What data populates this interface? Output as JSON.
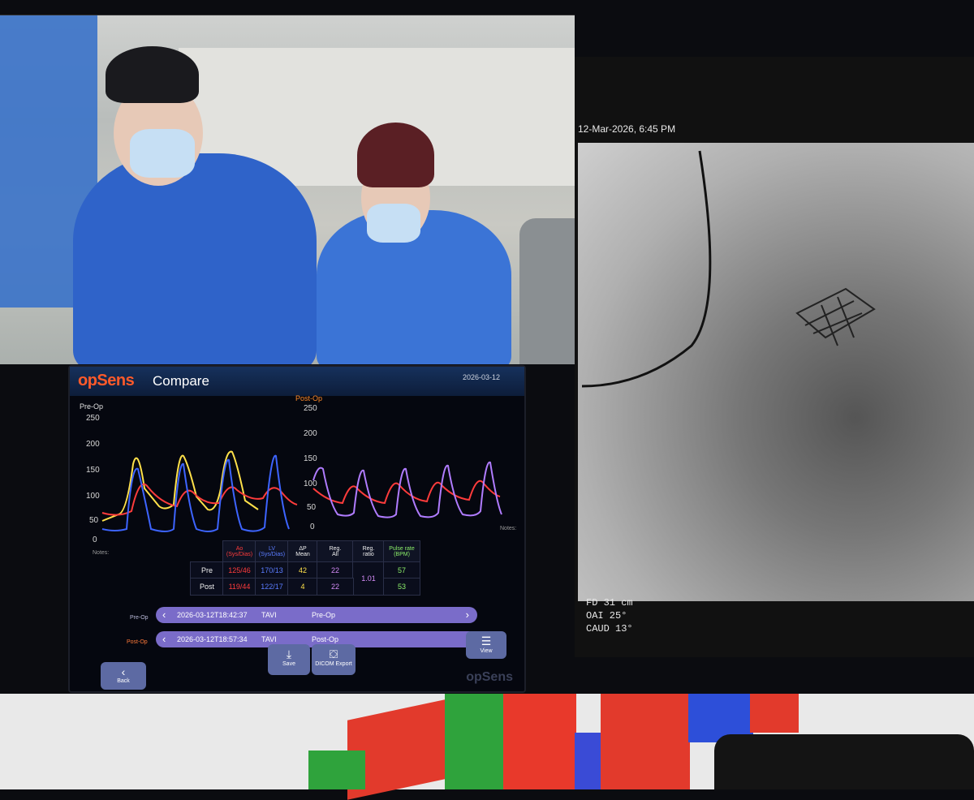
{
  "camera": {
    "label": ""
  },
  "xray": {
    "datetime": "12-Mar-2026, 6:45 PM",
    "fd": "FD    31 cm",
    "oai": "OAI   25°",
    "caud": "CAUD  13°"
  },
  "opsens": {
    "logo": "opSens",
    "title": "Compare",
    "date": "2026-03-12",
    "preop_label": "Pre-Op",
    "postop_label": "Post-Op",
    "y_ticks": [
      "250",
      "200",
      "150",
      "100",
      "50",
      "0"
    ],
    "notes_label": "Notes:",
    "table": {
      "headers": [
        "Ao\n(Sys/Dias)",
        "LV\n(Sys/Dias)",
        "ΔP\nMean",
        "Reg.\nAll",
        "Reg.\nratio",
        "Pulse rate\n(BPM)"
      ],
      "rows": [
        {
          "label": "Pre",
          "ao": "125/46",
          "lv": "170/13",
          "dp": "42",
          "reg": "22",
          "ratio": "1.01",
          "pulse": "57"
        },
        {
          "label": "Post",
          "ao": "119/44",
          "lv": "122/17",
          "dp": "4",
          "reg": "22",
          "ratio": "",
          "pulse": "53"
        }
      ]
    },
    "records": [
      {
        "side": "Pre-Op",
        "timestamp": "2026-03-12T18:42:37",
        "procedure": "TAVI",
        "phase": "Pre-Op"
      },
      {
        "side": "Post-Op",
        "timestamp": "2026-03-12T18:57:34",
        "procedure": "TAVI",
        "phase": "Post-Op"
      }
    ],
    "buttons": {
      "back": "Back",
      "save": "Save",
      "dicom": "DICOM Export",
      "view": "View"
    },
    "watermark": "opSens",
    "colors": {
      "ao": "#ff3c3c",
      "lv": "#5b7cff",
      "yellow": "#ffe14a",
      "purple": "#d48cf7"
    }
  }
}
